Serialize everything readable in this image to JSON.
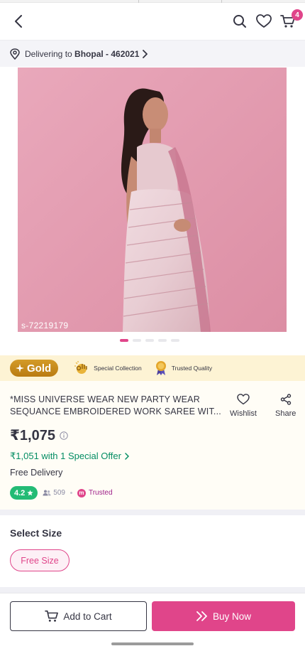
{
  "header": {
    "cart_count": "4"
  },
  "delivery": {
    "prefix": "Delivering to ",
    "location": "Bhopal - 462021"
  },
  "gallery": {
    "image_code": "s-72219179",
    "dot_count": 5,
    "active_dot": 1
  },
  "gold": {
    "label": "Gold",
    "feature1": "Special Collection",
    "feature2": "Trusted Quality"
  },
  "product": {
    "title": "*MISS UNIVERSE WEAR NEW PARTY WEAR SEQUANCE EMBROIDERED WORK SAREE WIT...",
    "wishlist_label": "Wishlist",
    "share_label": "Share",
    "price": "₹1,075",
    "offer": "₹1,051 with 1 Special Offer",
    "delivery": "Free Delivery",
    "rating": "4.2",
    "reviews": "509",
    "trusted_label": "Trusted"
  },
  "size": {
    "title": "Select Size",
    "selected": "Free Size"
  },
  "actions": {
    "add_to_cart": "Add to Cart",
    "buy_now": "Buy Now"
  },
  "colors": {
    "accent": "#e0458a",
    "green": "#038d63",
    "rating_green": "#23bb75",
    "gold_bg": "#fdf3d4"
  }
}
